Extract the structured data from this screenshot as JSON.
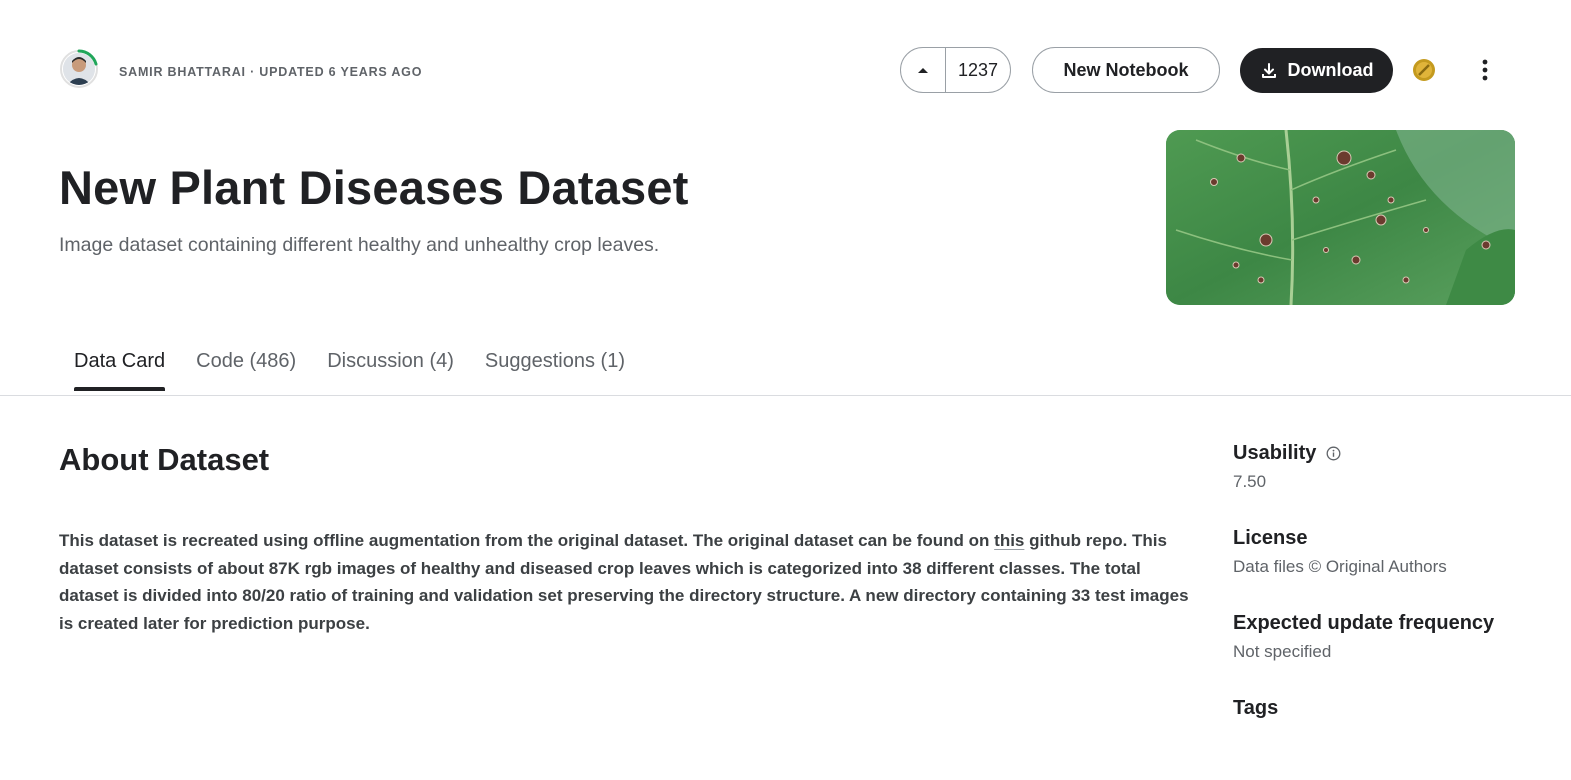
{
  "header": {
    "byline": "SAMIR BHATTARAI · UPDATED 6 YEARS AGO",
    "vote_count": "1237",
    "new_notebook_label": "New Notebook",
    "download_label": "Download",
    "medal_color": "#c49a1e"
  },
  "dataset": {
    "title": "New Plant Diseases Dataset",
    "subtitle": "Image dataset containing different healthy and unhealthy crop leaves."
  },
  "tabs": [
    {
      "label": "Data Card",
      "active": true
    },
    {
      "label": "Code (486)",
      "active": false
    },
    {
      "label": "Discussion (4)",
      "active": false
    },
    {
      "label": "Suggestions (1)",
      "active": false
    }
  ],
  "about": {
    "heading": "About Dataset",
    "text_before_link": "This dataset is recreated using offline augmentation from the original dataset. The original dataset can be found on ",
    "link_text": "this",
    "text_after_link": " github repo. This dataset consists of about 87K rgb images of healthy and diseased crop leaves which is categorized into 38 different classes. The total dataset is divided into 80/20 ratio of training and validation set preserving the directory structure. A new directory containing 33 test images is created later for prediction purpose."
  },
  "sidebar": {
    "usability": {
      "label": "Usability",
      "value": "7.50"
    },
    "license": {
      "label": "License",
      "value": "Data files © Original Authors"
    },
    "update_frequency": {
      "label": "Expected update frequency",
      "value": "Not specified"
    },
    "tags": {
      "label": "Tags"
    }
  },
  "colors": {
    "accent_dark": "#202124",
    "muted_text": "#5f6368",
    "progress_ring": "#20a65a"
  },
  "icons": {
    "upvote": "caret-up-icon",
    "download": "download-icon",
    "info": "info-icon",
    "menu": "kebab-menu-icon"
  }
}
